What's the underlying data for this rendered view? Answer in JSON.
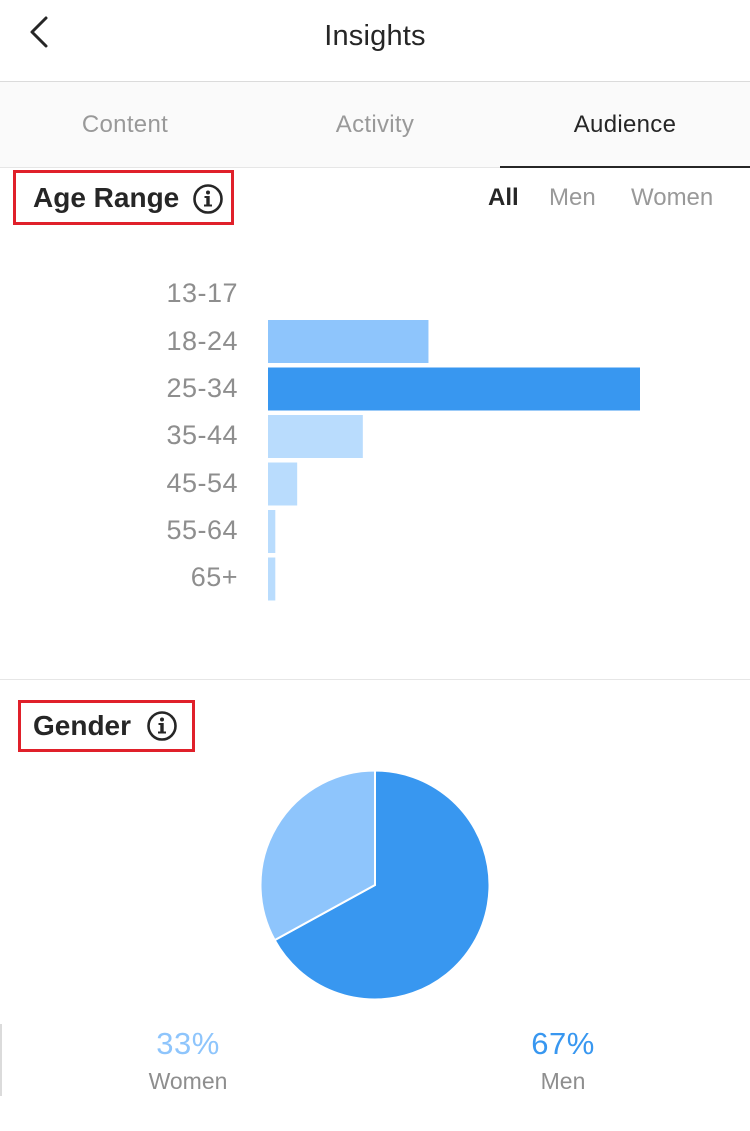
{
  "header": {
    "title": "Insights"
  },
  "tabs": [
    {
      "label": "Content",
      "active": false
    },
    {
      "label": "Activity",
      "active": false
    },
    {
      "label": "Audience",
      "active": true
    }
  ],
  "age_section": {
    "title": "Age Range",
    "filters": [
      {
        "label": "All",
        "active": true
      },
      {
        "label": "Men",
        "active": false
      },
      {
        "label": "Women",
        "active": false
      }
    ]
  },
  "gender_section": {
    "title": "Gender",
    "stats": [
      {
        "percent": "33%",
        "label": "Women",
        "color": "#8ec5fc"
      },
      {
        "percent": "67%",
        "label": "Men",
        "color": "#3897f0"
      }
    ]
  },
  "colors": {
    "accent": "#3897f0",
    "light_blue": "#8ec5fc",
    "pale_blue": "#b9dcfd",
    "highlight_red": "#e0202a"
  },
  "chart_data": [
    {
      "type": "bar",
      "orientation": "horizontal",
      "categories": [
        "13-17",
        "18-24",
        "25-34",
        "35-44",
        "45-54",
        "55-64",
        "65+"
      ],
      "values": [
        0,
        22,
        51,
        13,
        4,
        1,
        1
      ],
      "unit": "%",
      "highlight_category": "25-34"
    },
    {
      "type": "pie",
      "labels": [
        "Women",
        "Men"
      ],
      "values": [
        33,
        67
      ]
    }
  ]
}
